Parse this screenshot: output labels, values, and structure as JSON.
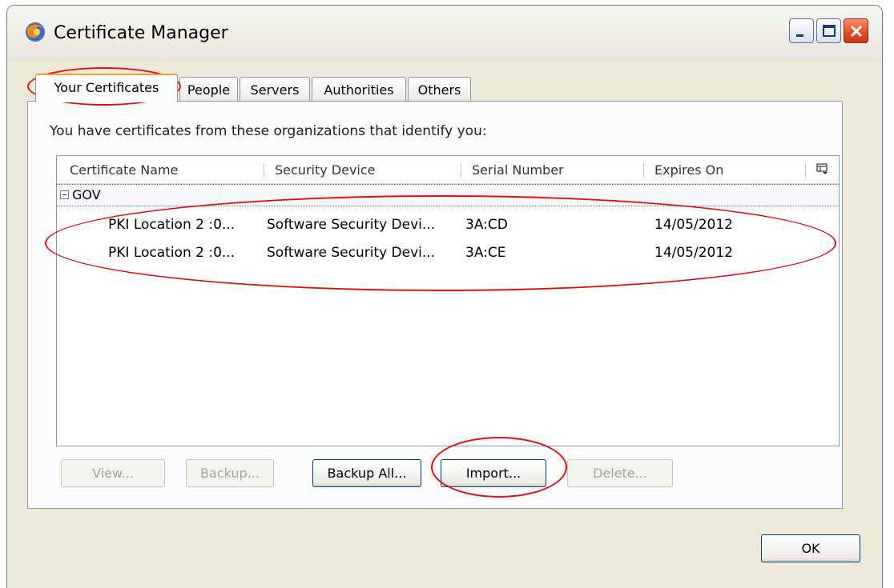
{
  "window": {
    "title": "Certificate Manager"
  },
  "tabs": [
    {
      "label": "Your Certificates",
      "active": true
    },
    {
      "label": "People"
    },
    {
      "label": "Servers"
    },
    {
      "label": "Authorities"
    },
    {
      "label": "Others"
    }
  ],
  "panel": {
    "intro": "You have certificates from these organizations that identify you:"
  },
  "table": {
    "columns": [
      "Certificate Name",
      "Security Device",
      "Serial Number",
      "Expires On"
    ],
    "group": "GOV",
    "rows": [
      {
        "name": "PKI Location 2 :0...",
        "device": "Software Security Devi...",
        "serial": "3A:CD",
        "expires": "14/05/2012"
      },
      {
        "name": "PKI Location 2 :0...",
        "device": "Software Security Devi...",
        "serial": "3A:CE",
        "expires": "14/05/2012"
      }
    ]
  },
  "buttons": {
    "view": "View...",
    "backup": "Backup...",
    "backup_all": "Backup All...",
    "import": "Import...",
    "delete": "Delete...",
    "ok": "OK"
  },
  "colors": {
    "annotation": "#e01010",
    "active_tab_accent": "#f0a030",
    "window_bg": "#ECE9D8"
  },
  "icons": [
    "firefox-logo-icon",
    "minimize-icon",
    "maximize-icon",
    "close-icon",
    "column-picker-icon",
    "collapse-icon"
  ]
}
